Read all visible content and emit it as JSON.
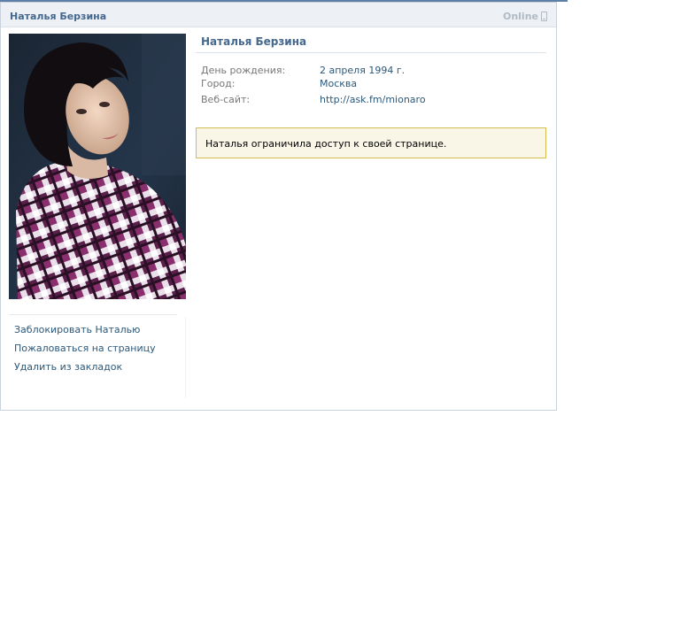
{
  "header": {
    "name": "Наталья Берзина",
    "status": "Online",
    "status_icon": "mobile-phone-icon"
  },
  "photo": {
    "description_icon": "profile-photo"
  },
  "actions": [
    {
      "label": "Заблокировать Наталью"
    },
    {
      "label": "Пожаловаться на страницу"
    },
    {
      "label": "Удалить из закладок"
    }
  ],
  "profile": {
    "name": "Наталья Берзина",
    "info": [
      {
        "label": "День рождения:",
        "value": "2 апреля 1994 г."
      },
      {
        "label": "Город:",
        "value": "Москва"
      },
      {
        "label": "Веб-сайт:",
        "value": "http://ask.fm/mionaro"
      }
    ]
  },
  "notice": {
    "text": "Наталья ограничила доступ к своей странице."
  },
  "colors": {
    "link": "#2b587a",
    "name": "#45688e",
    "header_bg": "#edf1f5",
    "notice_bg": "#f9f6e7",
    "notice_border": "#d4bc4c"
  }
}
